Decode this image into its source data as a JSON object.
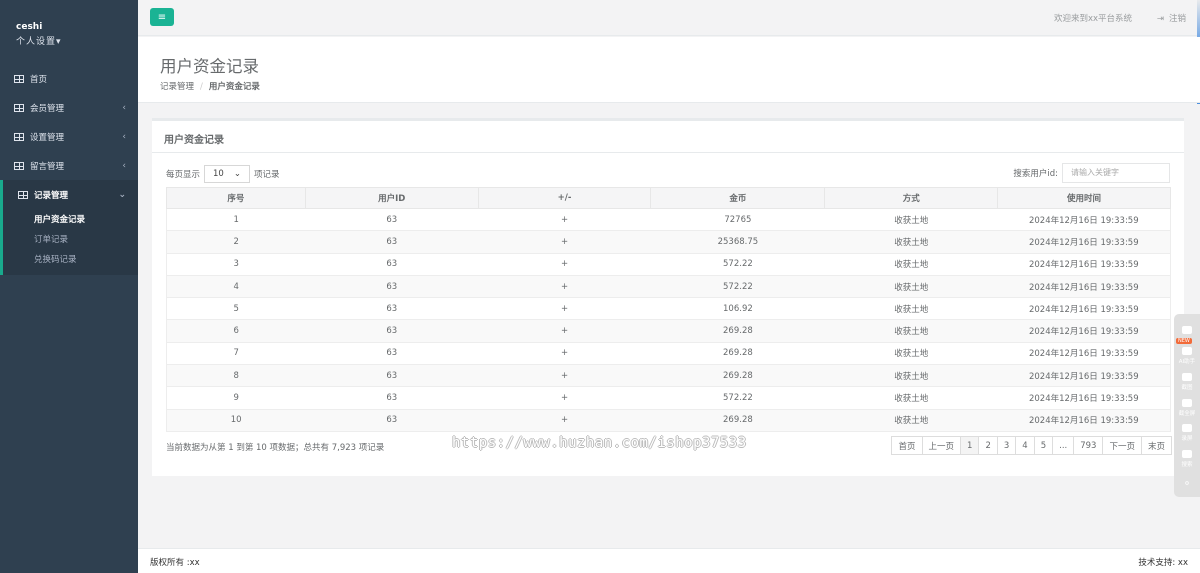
{
  "sidebar": {
    "username": "ceshi",
    "settings_label": "个人设置",
    "items": [
      {
        "label": "首页",
        "has_arrow": false
      },
      {
        "label": "会员管理",
        "has_arrow": true
      },
      {
        "label": "设置管理",
        "has_arrow": true
      },
      {
        "label": "留言管理",
        "has_arrow": true
      },
      {
        "label": "记录管理",
        "has_arrow": true
      }
    ],
    "subitems": [
      {
        "label": "用户资金记录"
      },
      {
        "label": "订单记录"
      },
      {
        "label": "兑换码记录"
      }
    ]
  },
  "topbar": {
    "menu_icon": "bars-icon",
    "welcome": "欢迎来到xx平台系统",
    "logout": "注销"
  },
  "heading": {
    "title": "用户资金记录",
    "breadcrumb_parent": "记录管理",
    "breadcrumb_sep": "/",
    "breadcrumb_current": "用户资金记录"
  },
  "panel": {
    "title": "用户资金记录",
    "length_prefix": "每页显示",
    "length_value": "10",
    "length_suffix": "项记录",
    "search_label": "搜索用户id:",
    "search_placeholder": "请输入关键字"
  },
  "table": {
    "headers": [
      "序号",
      "用户ID",
      "+/-",
      "金币",
      "方式",
      "使用时间"
    ],
    "rows": [
      [
        "1",
        "63",
        "+",
        "72765",
        "收获土地",
        "2024年12月16日 19:33:59"
      ],
      [
        "2",
        "63",
        "+",
        "25368.75",
        "收获土地",
        "2024年12月16日 19:33:59"
      ],
      [
        "3",
        "63",
        "+",
        "572.22",
        "收获土地",
        "2024年12月16日 19:33:59"
      ],
      [
        "4",
        "63",
        "+",
        "572.22",
        "收获土地",
        "2024年12月16日 19:33:59"
      ],
      [
        "5",
        "63",
        "+",
        "106.92",
        "收获土地",
        "2024年12月16日 19:33:59"
      ],
      [
        "6",
        "63",
        "+",
        "269.28",
        "收获土地",
        "2024年12月16日 19:33:59"
      ],
      [
        "7",
        "63",
        "+",
        "269.28",
        "收获土地",
        "2024年12月16日 19:33:59"
      ],
      [
        "8",
        "63",
        "+",
        "269.28",
        "收获土地",
        "2024年12月16日 19:33:59"
      ],
      [
        "9",
        "63",
        "+",
        "572.22",
        "收获土地",
        "2024年12月16日 19:33:59"
      ],
      [
        "10",
        "63",
        "+",
        "269.28",
        "收获土地",
        "2024年12月16日 19:33:59"
      ]
    ]
  },
  "info": "当前数据为从第 1 到第 10 项数据；总共有 7,923 项记录",
  "watermark": "https://www.huzhan.com/ishop37533",
  "pagination": [
    "首页",
    "上一页",
    "1",
    "2",
    "3",
    "4",
    "5",
    "...",
    "793",
    "下一页",
    "末页"
  ],
  "pagination_active": "1",
  "footer": {
    "copyright": "版权所有 :xx",
    "support": "技术支持: xx"
  },
  "floatbar": {
    "badge": "NEW",
    "items": [
      "AI助手",
      "截图",
      "截全屏",
      "录屏",
      "搜索"
    ]
  }
}
